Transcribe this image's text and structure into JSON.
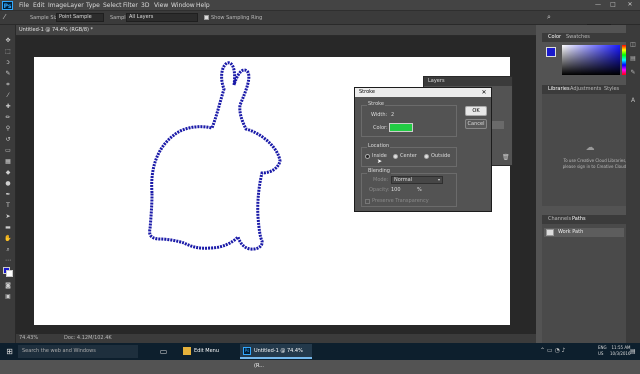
{
  "app": {
    "logo": "Ps"
  },
  "menubar": {
    "items": [
      "File",
      "Edit",
      "Image",
      "Layer",
      "Type",
      "Select",
      "Filter",
      "3D",
      "View",
      "Window",
      "Help"
    ],
    "minimize": "—",
    "maximize": "□",
    "close": "✕"
  },
  "options": {
    "sample_size_label": "Sample Size:",
    "sample_size_value": "Point Sample",
    "sample_label": "Sample:",
    "sample_value": "All Layers",
    "show_ring_label": "Show Sampling Ring"
  },
  "document": {
    "tab_title": "Untitled-1 @ 74.4% (RGB/8) *",
    "zoom": "74.43%",
    "doc_size": "Doc: 4.12M/102.4K"
  },
  "panels": {
    "color_tab": "Color",
    "swatches_tab": "Swatches",
    "libraries_tab": "Libraries",
    "adjustments_tab": "Adjustments",
    "styles_tab": "Styles",
    "libraries_message_1": "To use Creative Cloud Libraries,",
    "libraries_message_2": "please sign in to Creative Cloud.",
    "channels_tab": "Channels",
    "paths_tab": "Paths",
    "path_item": "Work Path",
    "layers_tab": "Layers"
  },
  "stroke_dialog": {
    "title": "Stroke",
    "stroke_group": "Stroke",
    "width_label": "Width:",
    "width_value": "2",
    "color_label": "Color:",
    "color_swatch": "#22cc44",
    "location_group": "Location",
    "inside": "Inside",
    "center": "Center",
    "outside": "Outside",
    "blending_group": "Blending",
    "mode_label": "Mode:",
    "mode_value": "Normal",
    "opacity_label": "Opacity:",
    "opacity_value": "100",
    "opacity_unit": "%",
    "preserve_label": "Preserve Transparency",
    "ok": "OK",
    "cancel": "Cancel"
  },
  "taskbar": {
    "search": "Search the web and Windows",
    "app1": "Edit Menu",
    "app2": "Untitled-1 @ 74.4% (R...",
    "lang1": "ENG",
    "lang2": "US",
    "time": "11:55 AM",
    "date": "10/3/2016"
  },
  "colors": {
    "foreground": "#1a1acc",
    "background": "#ffffff",
    "stroke": "#1a1aa8",
    "accent": "#31a8ff"
  },
  "icons": [
    "search-icon",
    "windows-icon",
    "task-view-icon",
    "folder-icon",
    "chrome-icon",
    "photoshop-icon",
    "creative-cloud-icon",
    "close-icon"
  ]
}
